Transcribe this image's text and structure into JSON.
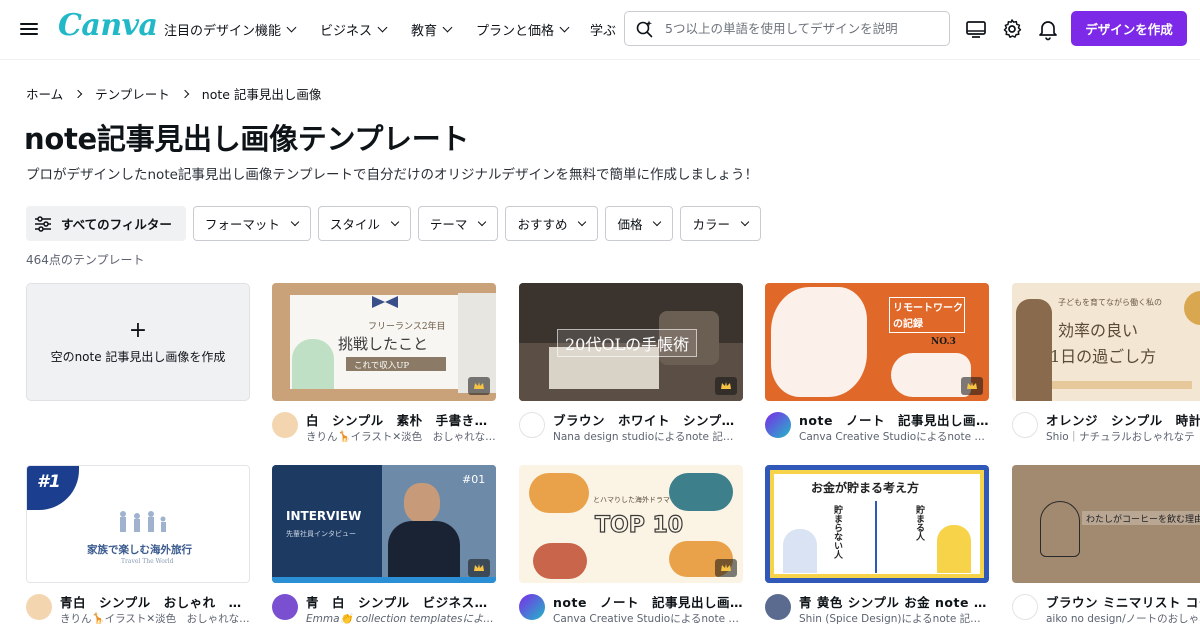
{
  "header": {
    "logo": "Canva",
    "nav": [
      {
        "label": "注目のデザイン機能"
      },
      {
        "label": "ビジネス"
      },
      {
        "label": "教育"
      },
      {
        "label": "プランと価格"
      }
    ],
    "nav_cut": "学ぶ",
    "search_placeholder": "5つ以上の単語を使用してデザインを説明",
    "create_button": "デザインを作成",
    "accent": "#7d2ae8"
  },
  "breadcrumb": [
    "ホーム",
    "テンプレート",
    "note 記事見出し画像"
  ],
  "page_title": "note記事見出し画像テンプレート",
  "subtitle": "プロがデザインしたnote記事見出し画像テンプレートで自分だけのオリジナルデザインを無料で簡単に作成しましょう！",
  "filters": {
    "all": "すべてのフィルター",
    "items": [
      "フォーマット",
      "スタイル",
      "テーマ",
      "おすすめ",
      "価格",
      "カラー"
    ]
  },
  "count": "464点のテンプレート",
  "empty_card": {
    "plus": "+",
    "label": "空のnote 記事見出し画像を作成"
  },
  "cards": [
    {
      "title": "白　シンプル　素朴　手書き　…",
      "author": "きりん🦒イラスト✕淡色　おしゃれな…",
      "thumb_text": [
        "フリーランス2年目",
        "挑戦したこと",
        "これで収入UP"
      ]
    },
    {
      "title": "ブラウン　ホワイト　シンプル…",
      "author": "Nana design studioによるnote 記事…",
      "thumb_text": [
        "20代OLの手帳術"
      ]
    },
    {
      "title": "note　ノート　記事見出し画像…",
      "author": "Canva Creative Studioによるnote …",
      "thumb_text": [
        "リモートワーク",
        "の記録",
        "NO.3"
      ]
    },
    {
      "title": "オレンジ　シンプル　時計",
      "author": "Shio｜ナチュラルおしゃれなテ",
      "thumb_text": [
        "子どもを育てながら働く私の",
        "効率の良い",
        "1日の過ごし方"
      ]
    },
    {
      "title": "青白　シンプル　おしゃれ　余…",
      "author": "きりん🦒イラスト✕淡色　おしゃれな…",
      "thumb_text": [
        "#1",
        "家族で楽しむ海外旅行",
        "Travel The World"
      ]
    },
    {
      "title": "青　白　シンプル　ビジネス　…",
      "author": "Emma👏 collection templatesによる…",
      "thumb_text": [
        "INTERVIEW",
        "#01",
        "先輩社員インタビュー"
      ]
    },
    {
      "title": "note　ノート　記事見出し画像…",
      "author": "Canva Creative Studioによるnote …",
      "thumb_text": [
        "とハマりした海外ドラマ",
        "TOP 10"
      ]
    },
    {
      "title": "青 黄色 シンプル お金 note ノー…",
      "author": "Shin (Spice Design)によるnote 記事…",
      "thumb_text": [
        "お金が貯まる考え方",
        "貯まらない人",
        "貯まる人"
      ]
    },
    {
      "title": "ブラウン ミニマリスト コー",
      "author": "aiko no design/ノートのおしゃれで",
      "thumb_text": [
        "わたしがコーヒーを飲む理由"
      ]
    }
  ]
}
